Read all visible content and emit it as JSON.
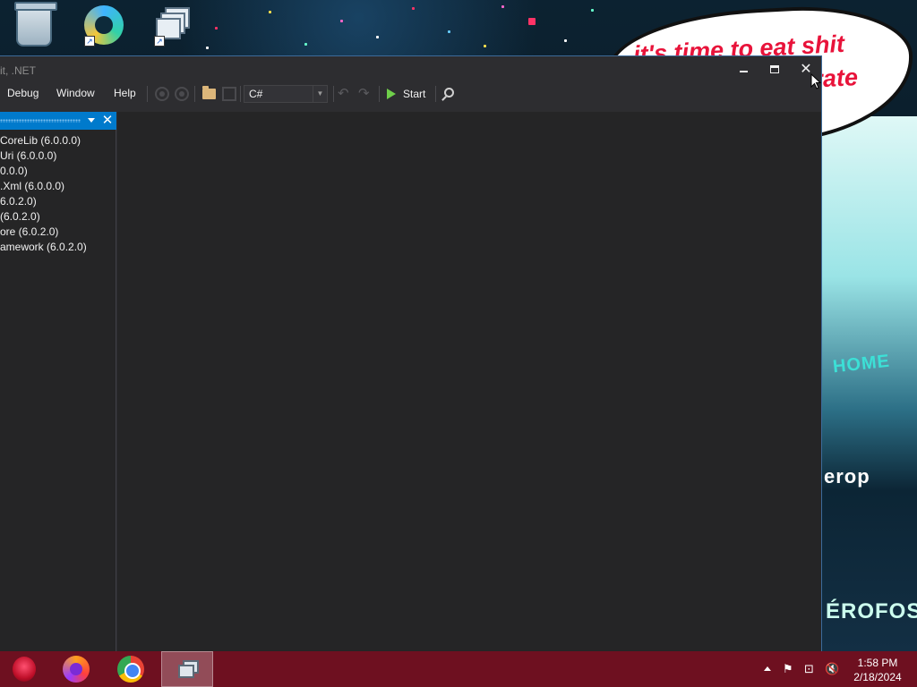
{
  "wallpaper": {
    "bubble_line1": "it's time to eat shit",
    "bubble_line2": "ebrate",
    "sign_home": "HOME",
    "sign_erop": "erop",
    "sign_erofos": "ÉROFOS",
    "bubble_text_color": "#e8133a"
  },
  "desktop_icons": [
    {
      "icon": "recycle-bin-icon"
    },
    {
      "icon": "browser-shortcut-icon"
    },
    {
      "icon": "application-shortcut-icon"
    }
  ],
  "window": {
    "title": "it, .NET",
    "accent": "#007acc",
    "controls": {
      "minimize": "minimize",
      "maximize": "maximize",
      "close": "✕"
    }
  },
  "menu": {
    "items": [
      "Debug",
      "Window",
      "Help"
    ]
  },
  "toolbar": {
    "language": "C#",
    "start_label": "Start",
    "undo": "↶",
    "redo": "↷"
  },
  "assembly_panel": {
    "close": "✕",
    "items": [
      " CoreLib (6.0.0.0)",
      " Uri (6.0.0.0)",
      "0.0.0)",
      ".Xml (6.0.0.0)",
      "6.0.2.0)",
      "(6.0.2.0)",
      "ore (6.0.2.0)",
      "amework (6.0.2.0)"
    ]
  },
  "taskbar": {
    "time": "1:58 PM",
    "date": "2/18/2024",
    "background": "#6e1020",
    "apps": [
      "start-orb",
      "firefox",
      "chrome",
      "application-window"
    ]
  }
}
